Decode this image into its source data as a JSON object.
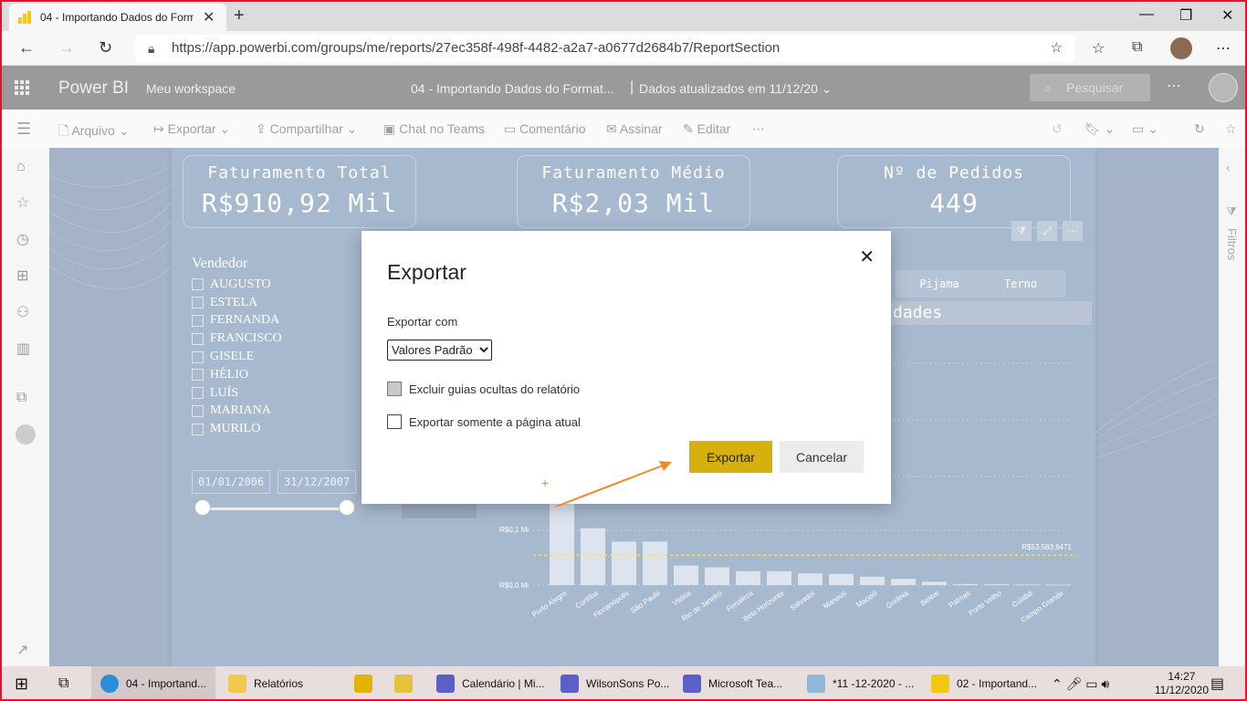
{
  "browser": {
    "tab_title": "04 - Importando Dados do Forma",
    "url": "https://app.powerbi.com/groups/me/reports/27ec358f-498f-4482-a2a7-a0677d2684b7/ReportSection"
  },
  "pbi_header": {
    "brand": "Power BI",
    "workspace": "Meu workspace",
    "report_title": "04 - Importando Dados do Format...",
    "updated": "Dados atualizados em 11/12/20",
    "search_placeholder": "Pesquisar"
  },
  "action_bar": {
    "file": "Arquivo",
    "export": "Exportar",
    "share": "Compartilhar",
    "teams": "Chat no Teams",
    "comment": "Comentário",
    "subscribe": "Assinar",
    "edit": "Editar"
  },
  "filters_label": "Filtros",
  "report": {
    "kpis": [
      {
        "label": "Faturamento Total",
        "value": "R$910,92 Mil"
      },
      {
        "label": "Faturamento Médio",
        "value": "R$2,03 Mil"
      },
      {
        "label": "Nº de Pedidos",
        "value": "449"
      }
    ],
    "seller_title": "Vendedor",
    "sellers": [
      "AUGUSTO",
      "ESTELA",
      "FERNANDA",
      "FRANCISCO",
      "GISELE",
      "HÉLIO",
      "LUÍS",
      "MARIANA",
      "MURILO"
    ],
    "date_start": "01/01/2006",
    "date_end": "31/12/2007",
    "product_buttons": [
      "Pijama",
      "Terno"
    ],
    "section_title": "dades",
    "y_labels": [
      "R$0,1 Mi",
      "R$0,0 Mi"
    ],
    "avg_label": "R$53.583,6471"
  },
  "chart_data": {
    "type": "bar",
    "categories": [
      "Porto Alegre",
      "Curitiba",
      "Florianópolis",
      "São Paulo",
      "Vitória",
      "Rio de Janeiro",
      "Fortaleza",
      "Belo Horizonte",
      "Salvador",
      "Manaus",
      "Maceió",
      "Goiânia",
      "Belém",
      "Palmas",
      "Porto Velho",
      "Cuiabá",
      "Campo Grande"
    ],
    "values": [
      150000,
      102000,
      78000,
      78000,
      35000,
      32000,
      25000,
      25000,
      21000,
      20000,
      15000,
      11000,
      6000,
      2000,
      1500,
      1000,
      800
    ],
    "reference_line": 53583.6471,
    "y_tick_labels": [
      "R$0,1 Mi",
      "R$0,0 Mi"
    ]
  },
  "dialog": {
    "title": "Exportar",
    "export_with_label": "Exportar com",
    "selected_option": "Valores Padrão",
    "option1": "Excluir guias ocultas do relatório",
    "option2": "Exportar somente a página atual",
    "primary": "Exportar",
    "secondary": "Cancelar"
  },
  "taskbar": {
    "items": [
      "04 - Importand...",
      "Relatórios",
      "Calendário | Mi...",
      "WilsonSons Po...",
      "Microsoft Tea...",
      "*11 -12-2020 - ...",
      "02 - Importand..."
    ],
    "time": "14:27",
    "date": "11/12/2020"
  }
}
